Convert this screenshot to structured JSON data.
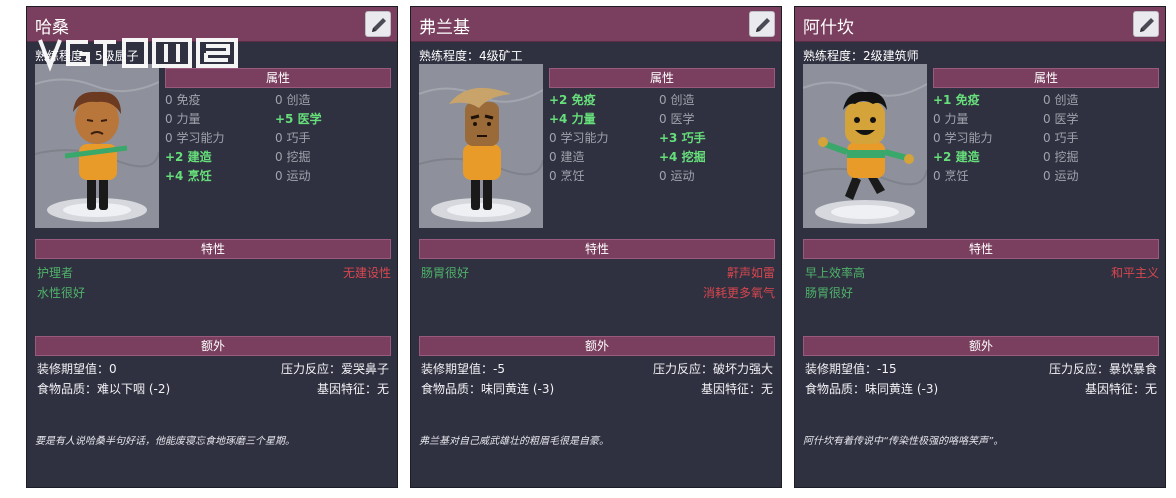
{
  "cards": [
    {
      "name": "哈桑",
      "skill_line": "熟练程度：5级厨子",
      "attributes_header": "属性",
      "attributes": [
        [
          {
            "text": "0 免疫",
            "pos": false
          },
          {
            "text": "0 创造",
            "pos": false
          }
        ],
        [
          {
            "text": "0 力量",
            "pos": false
          },
          {
            "text": "+5 医学",
            "pos": true
          }
        ],
        [
          {
            "text": "0 学习能力",
            "pos": false
          },
          {
            "text": "0 巧手",
            "pos": false
          }
        ],
        [
          {
            "text": "+2 建造",
            "pos": true
          },
          {
            "text": "0 挖掘",
            "pos": false
          }
        ],
        [
          {
            "text": "+4 烹饪",
            "pos": true
          },
          {
            "text": "0 运动",
            "pos": false
          }
        ]
      ],
      "traits_header": "特性",
      "traits_good": [
        "护理者",
        "水性很好"
      ],
      "traits_bad": [
        "无建设性"
      ],
      "extras_header": "额外",
      "decor": "装修期望值：0",
      "stress": "压力反应：爱哭鼻子",
      "food": "食物品质：难以下咽 (-2)",
      "gene": "基因特征：无",
      "quote": "要是有人说哈桑半句好话，他能废寝忘食地琢磨三个星期。",
      "colors": {
        "hair": "#6b3a20",
        "skin": "#b9763a",
        "shirt": "#e99b2a",
        "stripe": "#3aa86a",
        "pants": "#1a1a1a"
      }
    },
    {
      "name": "弗兰基",
      "skill_line": "熟练程度：4级矿工",
      "attributes_header": "属性",
      "attributes": [
        [
          {
            "text": "+2 免疫",
            "pos": true
          },
          {
            "text": "0 创造",
            "pos": false
          }
        ],
        [
          {
            "text": "+4 力量",
            "pos": true
          },
          {
            "text": "0 医学",
            "pos": false
          }
        ],
        [
          {
            "text": "0 学习能力",
            "pos": false
          },
          {
            "text": "+3 巧手",
            "pos": true
          }
        ],
        [
          {
            "text": "0 建造",
            "pos": false
          },
          {
            "text": "+4 挖掘",
            "pos": true
          }
        ],
        [
          {
            "text": "0 烹饪",
            "pos": false
          },
          {
            "text": "0 运动",
            "pos": false
          }
        ]
      ],
      "traits_header": "特性",
      "traits_good": [
        "肠胃很好"
      ],
      "traits_bad": [
        "鼾声如雷",
        "消耗更多氧气"
      ],
      "extras_header": "额外",
      "decor": "装修期望值：-5",
      "stress": "压力反应：破坏力强大",
      "food": "食物品质：味同黄连 (-3)",
      "gene": "基因特征：无",
      "quote": "弗兰基对自己威武雄壮的粗眉毛很是自豪。",
      "colors": {
        "hair": "#c9a46a",
        "skin": "#9a6a38",
        "shirt": "#e99b2a",
        "stripe": "#e99b2a",
        "pants": "#1a1a1a"
      }
    },
    {
      "name": "阿什坎",
      "skill_line": "熟练程度：2级建筑师",
      "attributes_header": "属性",
      "attributes": [
        [
          {
            "text": "+1 免疫",
            "pos": true
          },
          {
            "text": "0 创造",
            "pos": false
          }
        ],
        [
          {
            "text": "0 力量",
            "pos": false
          },
          {
            "text": "0 医学",
            "pos": false
          }
        ],
        [
          {
            "text": "0 学习能力",
            "pos": false
          },
          {
            "text": "0 巧手",
            "pos": false
          }
        ],
        [
          {
            "text": "+2 建造",
            "pos": true
          },
          {
            "text": "0 挖掘",
            "pos": false
          }
        ],
        [
          {
            "text": "0 烹饪",
            "pos": false
          },
          {
            "text": "0 运动",
            "pos": false
          }
        ]
      ],
      "traits_header": "特性",
      "traits_good": [
        "早上效率高",
        "肠胃很好"
      ],
      "traits_bad": [
        "和平主义"
      ],
      "extras_header": "额外",
      "decor": "装修期望值：-15",
      "stress": "压力反应：暴饮暴食",
      "food": "食物品质：味同黄连 (-3)",
      "gene": "基因特征：无",
      "quote": "阿什坎有着传说中“传染性极强的咯咯笑声”。",
      "colors": {
        "hair": "#121212",
        "skin": "#d4a33a",
        "shirt": "#e99b2a",
        "stripe": "#3aa86a",
        "pants": "#1a1a1a"
      }
    }
  ],
  "watermark": "VGTIME"
}
